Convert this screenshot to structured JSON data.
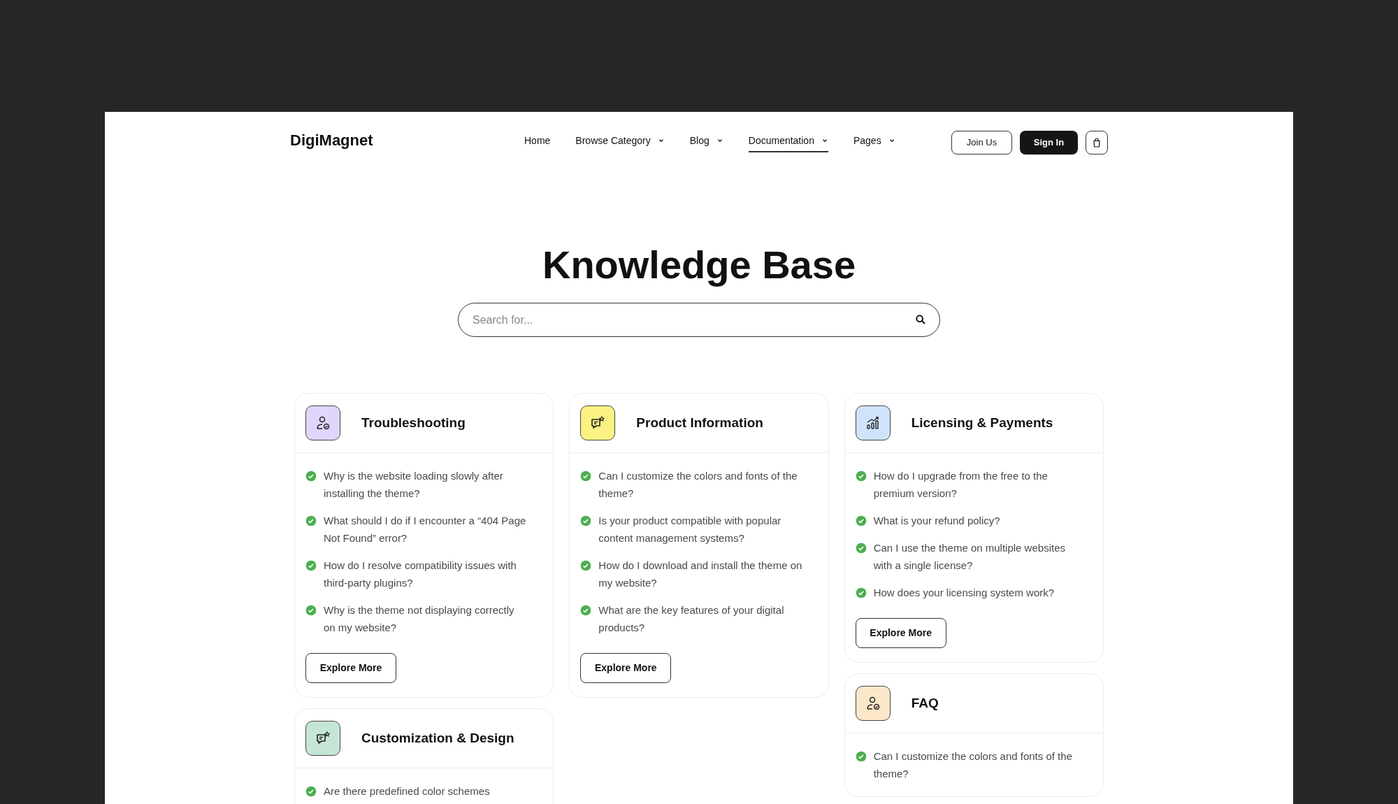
{
  "header": {
    "logo": "DigiMagnet",
    "nav": [
      {
        "label": "Home",
        "dropdown": false,
        "selected": false
      },
      {
        "label": "Browse Category",
        "dropdown": true,
        "selected": false
      },
      {
        "label": "Blog",
        "dropdown": true,
        "selected": false
      },
      {
        "label": "Documentation",
        "dropdown": true,
        "selected": true
      },
      {
        "label": "Pages",
        "dropdown": true,
        "selected": false
      }
    ],
    "join_button": "Join Us",
    "sign_in_button": "Sign In"
  },
  "hero": {
    "title": "Knowledge Base",
    "search": {
      "placeholder": "Search for..."
    }
  },
  "columns": [
    [
      {
        "title": "Troubleshooting",
        "kind": "person",
        "color": "#e2d5fb",
        "questions": [
          "Why is the website loading slowly after installing the theme?",
          "What should I do if I encounter a “404 Page Not Found” error?",
          "How do I resolve compatibility issues with third-party plugins?",
          "Why is the theme not displaying correctly on my website?"
        ],
        "button": "Explore More"
      },
      {
        "title": "Customization & Design",
        "kind": "chat",
        "color": "#c5e6d5",
        "questions": [
          "Are there predefined color schemes"
        ]
      }
    ],
    [
      {
        "title": "Product Information",
        "kind": "chat",
        "color": "#fcf283",
        "questions": [
          "Can I customize the colors and fonts of the theme?",
          "Is your product compatible with popular content management systems?",
          "How do I download and install the theme on my website?",
          "What are the key features of your digital products?"
        ],
        "button": "Explore More"
      }
    ],
    [
      {
        "title": "Licensing & Payments",
        "kind": "chart",
        "color": "#cfe4fb",
        "questions": [
          "How do I upgrade from the free to the premium version?",
          "What is your refund policy?",
          "Can I use the theme on multiple websites with a single license?",
          "How does your licensing system work?"
        ],
        "button": "Explore More"
      },
      {
        "title": "FAQ",
        "kind": "person",
        "color": "#fde7cb",
        "questions": [
          "Can I customize the colors and fonts of the theme?"
        ]
      }
    ]
  ]
}
